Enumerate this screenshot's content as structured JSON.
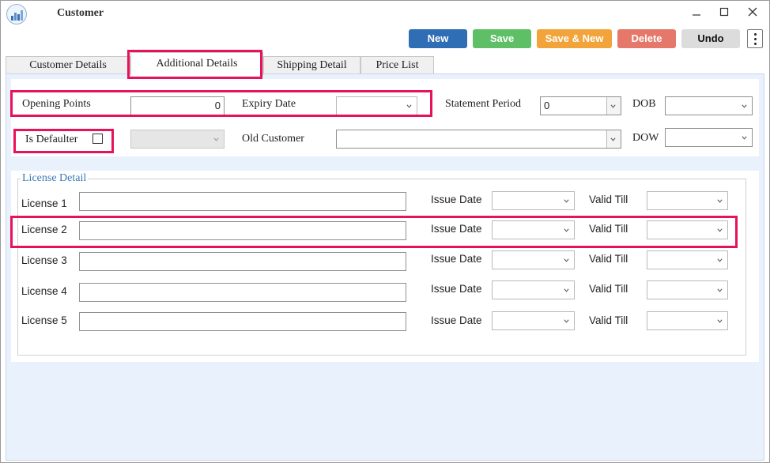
{
  "window": {
    "title": "Customer"
  },
  "toolbar": {
    "new_label": "New",
    "save_label": "Save",
    "save_new_label": "Save & New",
    "delete_label": "Delete",
    "undo_label": "Undo"
  },
  "tabs": [
    {
      "label": "Customer Details"
    },
    {
      "label": "Additional Details"
    },
    {
      "label": "Shipping Detail"
    },
    {
      "label": "Price List"
    }
  ],
  "fields": {
    "opening_points": {
      "label": "Opening Points",
      "value": "0"
    },
    "expiry_date": {
      "label": "Expiry Date",
      "value": ""
    },
    "statement_period": {
      "label": "Statement Period",
      "value": "0"
    },
    "dob": {
      "label": "DOB",
      "value": ""
    },
    "is_defaulter": {
      "label": "Is Defaulter",
      "checked": false
    },
    "old_customer": {
      "label": "Old Customer",
      "value": ""
    },
    "dow": {
      "label": "DOW",
      "value": ""
    }
  },
  "license": {
    "group_title": "License Detail",
    "issue_label": "Issue Date",
    "valid_label": "Valid Till",
    "rows": [
      {
        "label": "License 1",
        "value": "",
        "issue_date": "",
        "valid_till": ""
      },
      {
        "label": "License 2",
        "value": "",
        "issue_date": "",
        "valid_till": ""
      },
      {
        "label": "License 3",
        "value": "",
        "issue_date": "",
        "valid_till": ""
      },
      {
        "label": "License 4",
        "value": "",
        "issue_date": "",
        "valid_till": ""
      },
      {
        "label": "License 5",
        "value": "",
        "issue_date": "",
        "valid_till": ""
      }
    ]
  },
  "colors": {
    "highlight": "#e8125b",
    "new": "#2f6db5",
    "save": "#5fbf66",
    "save_new": "#f2a33a",
    "delete": "#e5786a",
    "undo": "#dcdcdc",
    "content_bg": "#e9f1fc",
    "group_title": "#3a78b5"
  },
  "icons": {
    "app": "bar-chart-icon",
    "minimize": "minimize-icon",
    "maximize": "maximize-icon",
    "close": "close-icon",
    "more": "kebab-menu-icon",
    "dropdown": "chevron-down-icon"
  }
}
